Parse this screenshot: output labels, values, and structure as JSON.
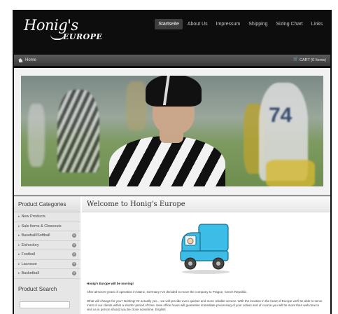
{
  "header": {
    "logo_script": "Honig's",
    "logo_sub": "EUROPE",
    "nav": [
      {
        "label": "Startseite",
        "active": true
      },
      {
        "label": "About Us",
        "active": false
      },
      {
        "label": "Impressum",
        "active": false
      },
      {
        "label": "Shipping",
        "active": false
      },
      {
        "label": "Sizing Chart",
        "active": false
      },
      {
        "label": "Links",
        "active": false
      }
    ]
  },
  "breadcrumb": {
    "home": "Home",
    "cart": "CART (0 Items)"
  },
  "sidebar": {
    "categories_title": "Product Categories",
    "items": [
      {
        "label": "New Products",
        "expandable": false
      },
      {
        "label": "Sale Items & Closeouts",
        "expandable": false
      },
      {
        "label": "Baseball/Softball",
        "expandable": true
      },
      {
        "label": "Eishockey",
        "expandable": true
      },
      {
        "label": "Football",
        "expandable": true
      },
      {
        "label": "Lacrosse",
        "expandable": true
      },
      {
        "label": "Basketball",
        "expandable": true
      }
    ],
    "search_title": "Product Search"
  },
  "main": {
    "title": "Welcome to Honig's Europe",
    "moving_heading": "Honig's Europe will be moving!",
    "para1": "After almost 8 years of operation in Mainz, Germany I've decided to move the company to Prague, Czech Republic.",
    "para2": "What will change for you? Nothing! Or actually yes... we will provide even quicker and more reliable service. With the location in the heart of Europe we'll be able to serve most of our clients within a shorter period of time. New office hours will guarantee immediate processing of your orders and of course you will be more than welcome to visit us in person should you be close sometime. English"
  },
  "colors": {
    "background": "#0d0d0d",
    "nav_active": "#3d3d3d",
    "truck": "#3bbde8"
  }
}
